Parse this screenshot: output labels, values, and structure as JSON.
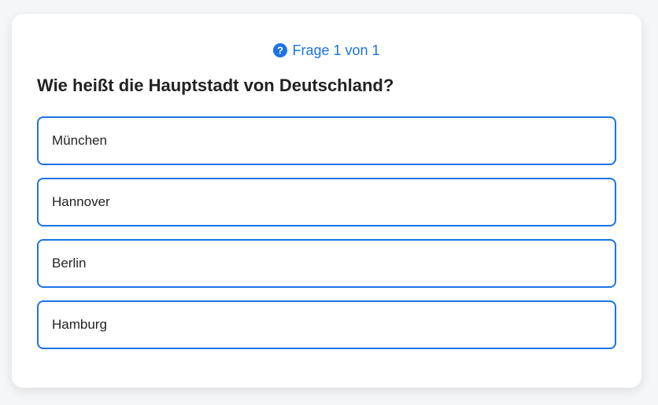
{
  "quiz": {
    "counter_text": "Frage 1 von 1",
    "counter_icon": "question-circle-icon",
    "accent_color": "#1a73e8",
    "question": "Wie heißt die Hauptstadt von Deutschland?",
    "options": [
      {
        "label": "München"
      },
      {
        "label": "Hannover"
      },
      {
        "label": "Berlin"
      },
      {
        "label": "Hamburg"
      }
    ]
  }
}
